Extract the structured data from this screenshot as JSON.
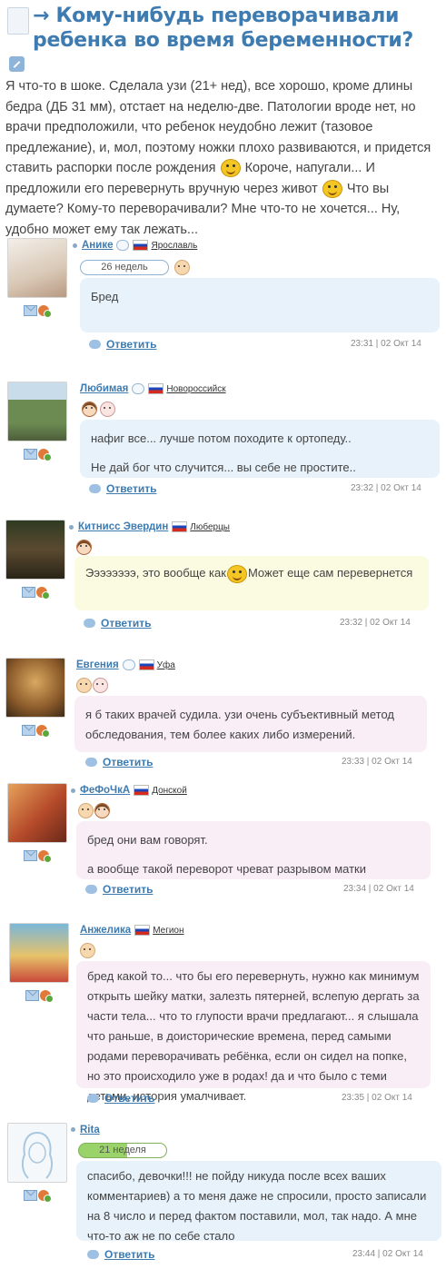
{
  "topic": {
    "title": "→ Кому-нибудь переворачивали ребенка во время беременности?",
    "body_1": "Я что-то в шоке. Сделала узи (21+ нед), все хорошо, кроме длины бедра (ДБ 31 мм), отстает на неделю-две. Патологии вроде нет, но врачи предположили, что ребенок неудобно лежит (тазовое предлежание), и, мол, поэтому ножки плохо развиваются, и придется ставить распорки после рождения",
    "body_2": "Короче, напугали... И предложили его перевернуть вручную через живот",
    "body_3": "Что вы думаете? Кому-то переворачивали? Мне что-то не хочется... Ну, удобно может ему так лежать..."
  },
  "comments": [
    {
      "name": "Анике",
      "city": "Ярославль",
      "weeks": "26 недель",
      "p1": "Бред",
      "p2": "",
      "reply": "Ответить",
      "time": "23:31 | 02 Окт 14"
    },
    {
      "name": "Любимая",
      "city": "Новороссийск",
      "weeks": "",
      "p1": "нафиг все... лучше потом походите к ортопеду..",
      "p2": "Не дай бог что случится... вы себе не простите..",
      "reply": "Ответить",
      "time": "23:32 | 02 Окт 14"
    },
    {
      "name": "Китнисс Эвердин",
      "city": "Люберцы",
      "weeks": "",
      "p1a": "Ээээээээ, это вообще как",
      "p1b": "Может еще сам перевернется",
      "reply": "Ответить",
      "time": "23:32 | 02 Окт 14"
    },
    {
      "name": "Евгения",
      "city": "Уфа",
      "weeks": "",
      "p1": "я б таких врачей судила. узи очень субъективный метод обследования, тем более каких либо измерений.",
      "p2": "",
      "reply": "Ответить",
      "time": "23:33 | 02 Окт 14"
    },
    {
      "name": "ФеФоЧкА",
      "city": "Донской",
      "weeks": "",
      "p1": "бред они вам говорят.",
      "p2": "а вообще такой переворот чреват разрывом матки",
      "reply": "Ответить",
      "time": "23:34 | 02 Окт 14"
    },
    {
      "name": "Анжелика",
      "city": "Мегион",
      "weeks": "",
      "p1": "бред какой то... что бы его перевернуть, нужно как минимум открыть шейку матки, залезть пятерней, вслепую дергать за части тела... что то глупости врачи предлагают... я слышала что раньше, в доисторические времена, перед самыми родами переворачивать ребёнка, если он сидел на попке, но это происходило уже в родах! да и что было с теми детьми, история умалчивает.",
      "p2": "",
      "reply": "Ответить",
      "time": "23:35 | 02 Окт 14"
    },
    {
      "name": "Rita",
      "city": "",
      "weeks": "21 неделя",
      "p1": "спасибо, девочки!!! не пойду никуда после всех ваших комментариев) а то меня даже не спросили, просто записали на 8 число и перед фактом поставили, мол, так надо. А мне что-то аж не по себе стало",
      "p2": "",
      "reply": "Ответить",
      "time": "23:44 | 02 Окт 14"
    }
  ],
  "colors": {
    "accent": "#3d7bb0",
    "bubble_blue": "#e8f2fb",
    "bubble_yellow": "#fbfbe2",
    "bubble_pink": "#f9eef5"
  }
}
